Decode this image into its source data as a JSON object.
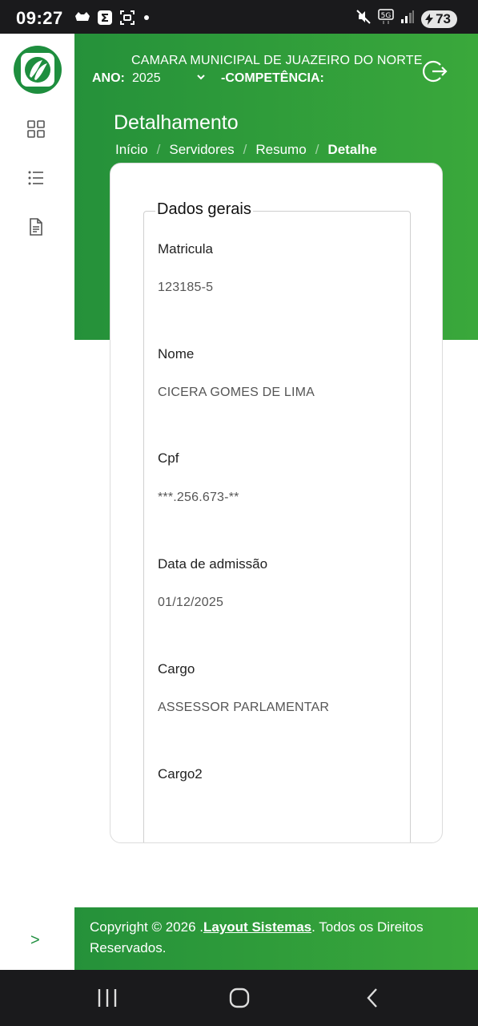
{
  "status_bar": {
    "time": "09:27",
    "battery": "73",
    "icons": [
      "cat-icon",
      "sigma-icon",
      "screenshot-icon",
      "mute-icon",
      "5g-icon",
      "signal-icon"
    ]
  },
  "header": {
    "org_name": "CAMARA MUNICIPAL DE JUAZEIRO DO NORTE",
    "ano_label": "ANO:",
    "ano_value": "2025",
    "competencia_label": "-COMPETÊNCIA:"
  },
  "page": {
    "title": "Detalhamento",
    "breadcrumb": [
      "Início",
      "Servidores",
      "Resumo",
      "Detalhe"
    ],
    "separator": "/"
  },
  "card": {
    "legend": "Dados gerais",
    "fields": [
      {
        "label": "Matricula",
        "value": "123185-5"
      },
      {
        "label": "Nome",
        "value": "CICERA GOMES DE LIMA"
      },
      {
        "label": "Cpf",
        "value": "***.256.673-**"
      },
      {
        "label": "Data de admissão",
        "value": "01/12/2025"
      },
      {
        "label": "Cargo",
        "value": "ASSESSOR PARLAMENTAR"
      },
      {
        "label": "Cargo2",
        "value": ""
      }
    ]
  },
  "footer": {
    "prefix": "Copyright © 2026 .",
    "link": "Layout Sistemas",
    "suffix": ". Todos os Direitos Reservados."
  },
  "sidebar": {
    "items": [
      "dashboard-icon",
      "list-icon",
      "document-icon"
    ],
    "expand_glyph": ">"
  },
  "colors": {
    "brand_green": "#2e9e3b",
    "dark_bar": "#1a1a1c"
  }
}
